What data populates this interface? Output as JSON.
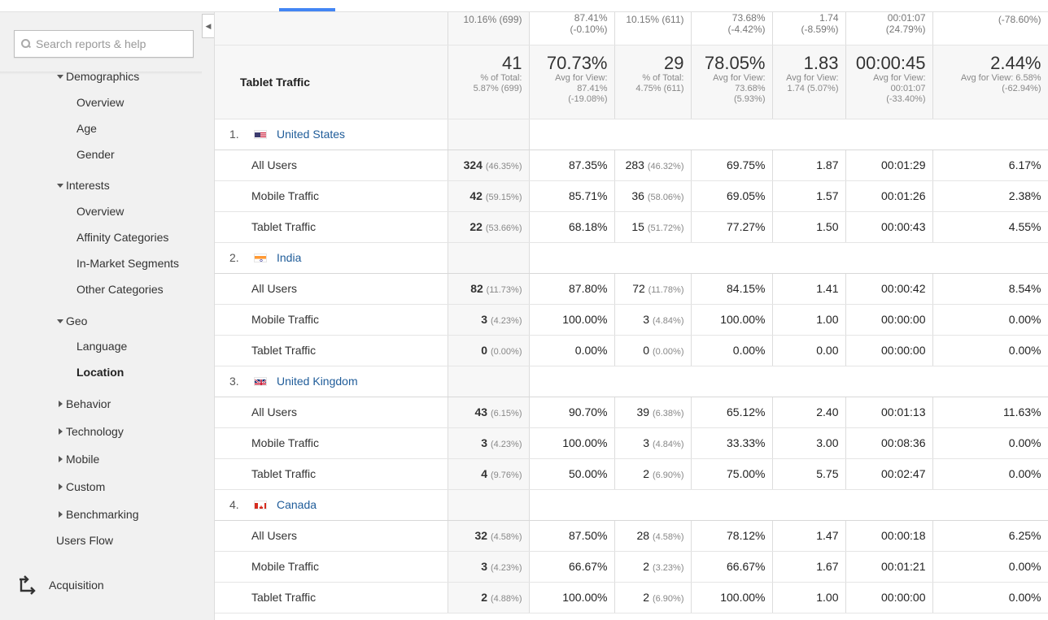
{
  "sidebar": {
    "search_placeholder": "Search reports & help",
    "demographics": {
      "label": "Demographics",
      "items": [
        "Overview",
        "Age",
        "Gender"
      ]
    },
    "interests": {
      "label": "Interests",
      "items": [
        "Overview",
        "Affinity Categories",
        "In-Market Segments",
        "Other Categories"
      ]
    },
    "geo": {
      "label": "Geo",
      "items": [
        "Language",
        "Location"
      ],
      "active": "Location"
    },
    "sections": [
      "Behavior",
      "Technology",
      "Mobile",
      "Custom",
      "Benchmarking"
    ],
    "users_flow": "Users Flow",
    "acquisition": "Acquisition"
  },
  "colors": {
    "accent": "#4285f4",
    "link": "#1f5c99"
  },
  "table": {
    "prev_row": [
      "10.16% (699)",
      "87.41%",
      "(-0.10%)",
      "10.15% (611)",
      "73.68%",
      "(-4.42%)",
      "1.74",
      "(-8.59%)",
      "00:01:07",
      "(24.79%)",
      "(-78.60%)"
    ],
    "summary": {
      "label": "Tablet Traffic",
      "c1": {
        "big": "41",
        "l1": "% of Total:",
        "l2": "5.87% (699)"
      },
      "c2": {
        "big": "70.73%",
        "l1": "Avg for View:",
        "l2": "87.41%",
        "l3": "(-19.08%)"
      },
      "c3": {
        "big": "29",
        "l1": "% of Total:",
        "l2": "4.75% (611)"
      },
      "c4": {
        "big": "78.05%",
        "l1": "Avg for View:",
        "l2": "73.68%",
        "l3": "(5.93%)"
      },
      "c5": {
        "big": "1.83",
        "l1": "Avg for View:",
        "l2": "1.74 (5.07%)"
      },
      "c6": {
        "big": "00:00:45",
        "l1": "Avg for View:",
        "l2": "00:01:07",
        "l3": "(-33.40%)"
      },
      "c7": {
        "big": "2.44%",
        "l1": "Avg for View: 6.58%",
        "l2": "(-62.94%)"
      }
    },
    "countries": [
      {
        "num": "1.",
        "name": "United States",
        "flag": "us-flag-icon",
        "rows": [
          {
            "seg": "All Users",
            "v1": "324",
            "p1": "(46.35%)",
            "v2": "87.35%",
            "v3": "283",
            "p3": "(46.32%)",
            "v4": "69.75%",
            "v5": "1.87",
            "v6": "00:01:29",
            "v7": "6.17%"
          },
          {
            "seg": "Mobile Traffic",
            "v1": "42",
            "p1": "(59.15%)",
            "v2": "85.71%",
            "v3": "36",
            "p3": "(58.06%)",
            "v4": "69.05%",
            "v5": "1.57",
            "v6": "00:01:26",
            "v7": "2.38%"
          },
          {
            "seg": "Tablet Traffic",
            "v1": "22",
            "p1": "(53.66%)",
            "v2": "68.18%",
            "v3": "15",
            "p3": "(51.72%)",
            "v4": "77.27%",
            "v5": "1.50",
            "v6": "00:00:43",
            "v7": "4.55%"
          }
        ]
      },
      {
        "num": "2.",
        "name": "India",
        "flag": "india-flag-icon",
        "rows": [
          {
            "seg": "All Users",
            "v1": "82",
            "p1": "(11.73%)",
            "v2": "87.80%",
            "v3": "72",
            "p3": "(11.78%)",
            "v4": "84.15%",
            "v5": "1.41",
            "v6": "00:00:42",
            "v7": "8.54%"
          },
          {
            "seg": "Mobile Traffic",
            "v1": "3",
            "p1": "(4.23%)",
            "v2": "100.00%",
            "v3": "3",
            "p3": "(4.84%)",
            "v4": "100.00%",
            "v5": "1.00",
            "v6": "00:00:00",
            "v7": "0.00%"
          },
          {
            "seg": "Tablet Traffic",
            "v1": "0",
            "p1": "(0.00%)",
            "v2": "0.00%",
            "v3": "0",
            "p3": "(0.00%)",
            "v4": "0.00%",
            "v5": "0.00",
            "v6": "00:00:00",
            "v7": "0.00%"
          }
        ]
      },
      {
        "num": "3.",
        "name": "United Kingdom",
        "flag": "uk-flag-icon",
        "rows": [
          {
            "seg": "All Users",
            "v1": "43",
            "p1": "(6.15%)",
            "v2": "90.70%",
            "v3": "39",
            "p3": "(6.38%)",
            "v4": "65.12%",
            "v5": "2.40",
            "v6": "00:01:13",
            "v7": "11.63%"
          },
          {
            "seg": "Mobile Traffic",
            "v1": "3",
            "p1": "(4.23%)",
            "v2": "100.00%",
            "v3": "3",
            "p3": "(4.84%)",
            "v4": "33.33%",
            "v5": "3.00",
            "v6": "00:08:36",
            "v7": "0.00%"
          },
          {
            "seg": "Tablet Traffic",
            "v1": "4",
            "p1": "(9.76%)",
            "v2": "50.00%",
            "v3": "2",
            "p3": "(6.90%)",
            "v4": "75.00%",
            "v5": "5.75",
            "v6": "00:02:47",
            "v7": "0.00%"
          }
        ]
      },
      {
        "num": "4.",
        "name": "Canada",
        "flag": "canada-flag-icon",
        "rows": [
          {
            "seg": "All Users",
            "v1": "32",
            "p1": "(4.58%)",
            "v2": "87.50%",
            "v3": "28",
            "p3": "(4.58%)",
            "v4": "78.12%",
            "v5": "1.47",
            "v6": "00:00:18",
            "v7": "6.25%"
          },
          {
            "seg": "Mobile Traffic",
            "v1": "3",
            "p1": "(4.23%)",
            "v2": "66.67%",
            "v3": "2",
            "p3": "(3.23%)",
            "v4": "66.67%",
            "v5": "1.67",
            "v6": "00:01:21",
            "v7": "0.00%"
          },
          {
            "seg": "Tablet Traffic",
            "v1": "2",
            "p1": "(4.88%)",
            "v2": "100.00%",
            "v3": "2",
            "p3": "(6.90%)",
            "v4": "100.00%",
            "v5": "1.00",
            "v6": "00:00:00",
            "v7": "0.00%"
          }
        ]
      }
    ]
  }
}
